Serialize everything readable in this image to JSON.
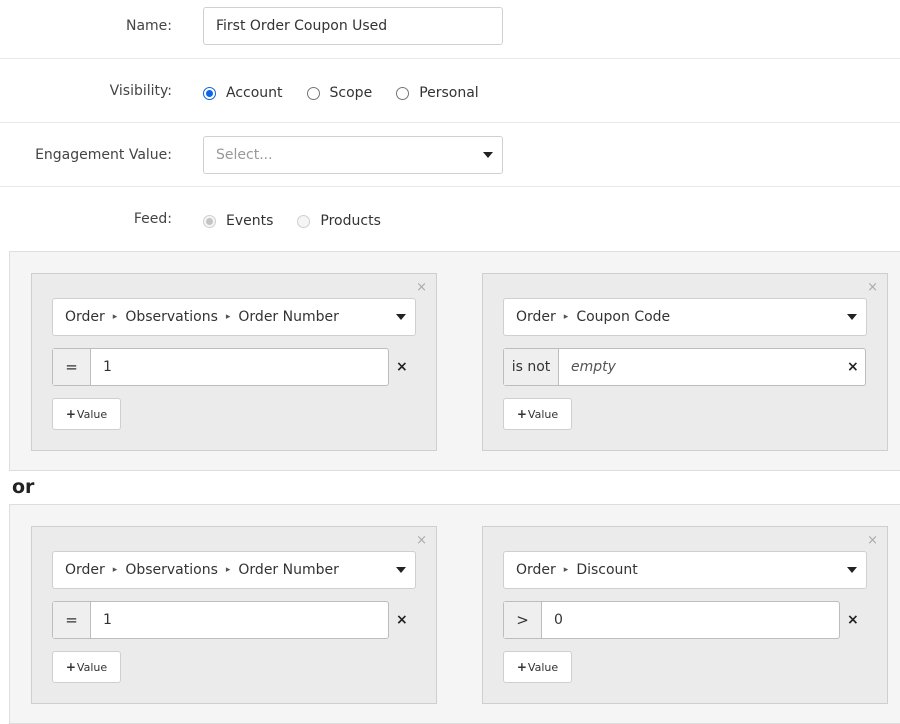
{
  "form": {
    "name": {
      "label": "Name:",
      "value": "First Order Coupon Used"
    },
    "visibility": {
      "label": "Visibility:",
      "options": [
        {
          "label": "Account",
          "checked": true
        },
        {
          "label": "Scope",
          "checked": false
        },
        {
          "label": "Personal",
          "checked": false
        }
      ]
    },
    "engagement": {
      "label": "Engagement Value:",
      "placeholder": "Select..."
    },
    "feed": {
      "label": "Feed:",
      "options": [
        {
          "label": "Events",
          "checked": true
        },
        {
          "label": "Products",
          "checked": false
        }
      ]
    }
  },
  "groups": [
    {
      "conditions": [
        {
          "path": [
            "Order",
            "Observations",
            "Order Number"
          ],
          "operator": "=",
          "value": "1",
          "add_label": "Value"
        },
        {
          "path": [
            "Order",
            "Coupon Code"
          ],
          "operator": "is not",
          "value": "empty",
          "add_label": "Value"
        }
      ]
    },
    {
      "conditions": [
        {
          "path": [
            "Order",
            "Observations",
            "Order Number"
          ],
          "operator": "=",
          "value": "1",
          "add_label": "Value"
        },
        {
          "path": [
            "Order",
            "Discount"
          ],
          "operator": ">",
          "value": "0",
          "add_label": "Value"
        }
      ]
    }
  ],
  "or_label": "or",
  "icons": {
    "path_separator": "▸",
    "remove": "×",
    "close": "×",
    "add": "+"
  },
  "colors": {
    "accent": "#0a66e4",
    "group_bg": "#f5f5f5",
    "card_bg": "#ebebeb"
  }
}
